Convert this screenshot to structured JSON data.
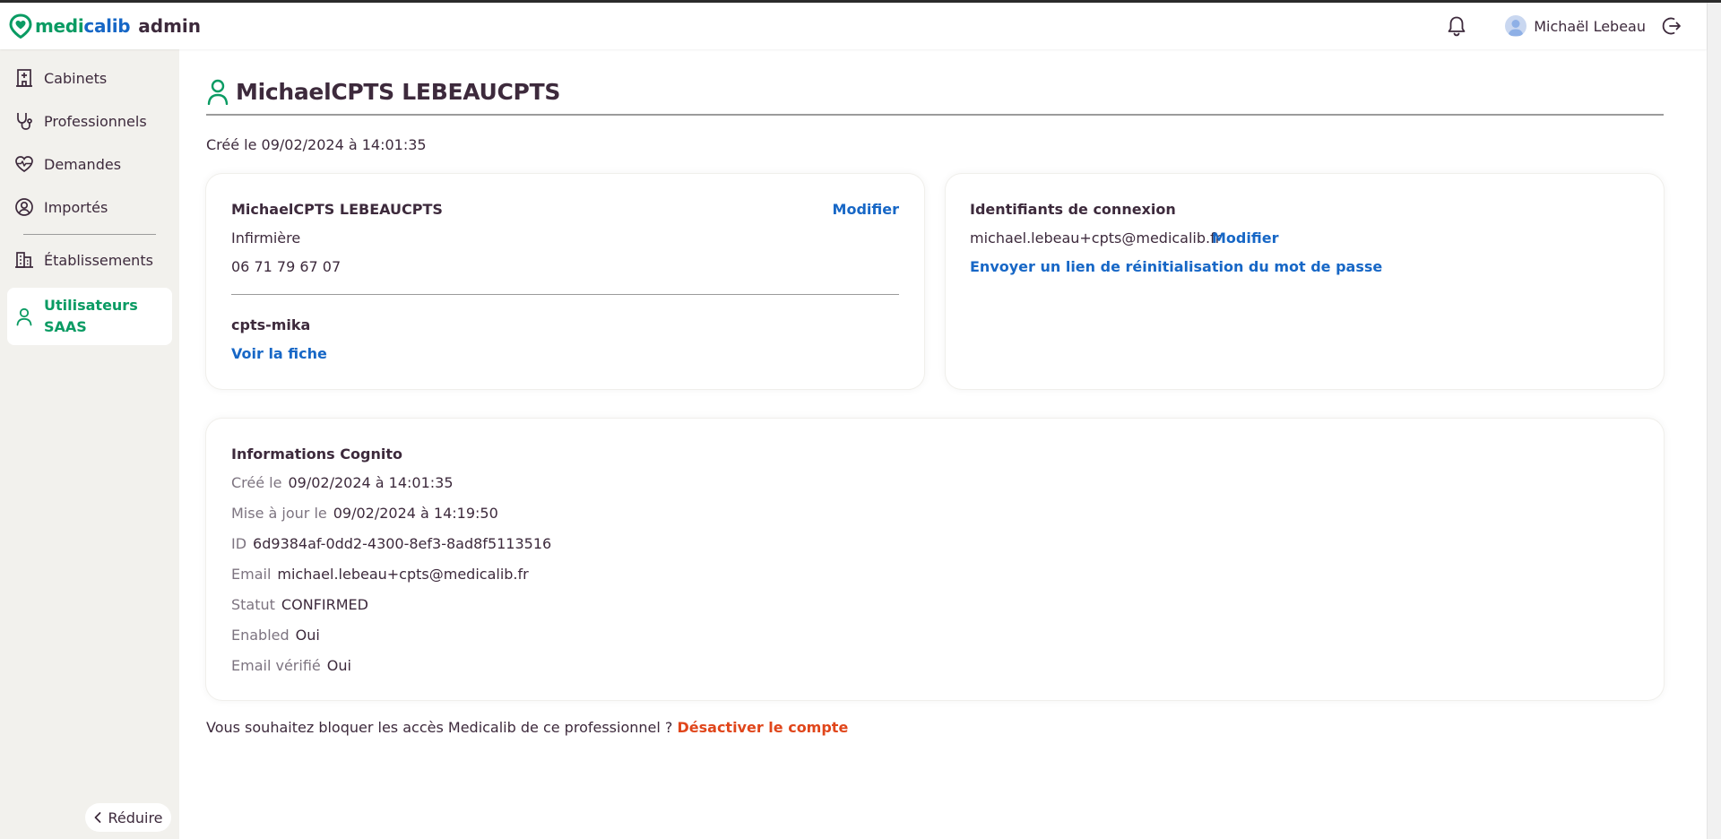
{
  "brand": {
    "logo_part1": "medi",
    "logo_part2": "calib",
    "suffix": "admin",
    "colors": {
      "green": "#0a9b63",
      "blue": "#1767c6",
      "dark": "#3d2a3c",
      "danger": "#e0461b"
    }
  },
  "header": {
    "user_name": "Michaël Lebeau",
    "icons": [
      "bell-icon",
      "avatar",
      "logout-icon"
    ]
  },
  "sidebar": {
    "items": [
      {
        "label": "Cabinets",
        "icon": "building-icon"
      },
      {
        "label": "Professionnels",
        "icon": "stethoscope-icon"
      },
      {
        "label": "Demandes",
        "icon": "heartbeat-icon"
      },
      {
        "label": "Importés",
        "icon": "user-circle-icon"
      },
      {
        "label": "Établissements",
        "icon": "hospital-icon"
      },
      {
        "label": "Utilisateurs SAAS",
        "icon": "user-icon",
        "active": true
      }
    ],
    "reduce_label": "Réduire"
  },
  "page": {
    "title": "MichaelCPTS LEBEAUCPTS",
    "created": "Créé le 09/02/2024 à 14:01:35"
  },
  "profile_card": {
    "name": "MichaelCPTS LEBEAUCPTS",
    "edit_label": "Modifier",
    "profession": "Infirmière",
    "phone": "06 71 79 67 07",
    "org": "cpts-mika",
    "view_label": "Voir la fiche"
  },
  "login_card": {
    "title": "Identifiants de connexion",
    "email": "michael.lebeau+cpts@medicalib.fr",
    "edit_label": "Modifier",
    "reset_label": "Envoyer un lien de réinitialisation du mot de passe"
  },
  "cognito": {
    "title": "Informations Cognito",
    "rows": [
      {
        "key": "Créé le",
        "value": "09/02/2024 à 14:01:35"
      },
      {
        "key": "Mise à jour le",
        "value": "09/02/2024 à 14:19:50"
      },
      {
        "key": "ID",
        "value": "6d9384af-0dd2-4300-8ef3-8ad8f5113516"
      },
      {
        "key": "Email",
        "value": "michael.lebeau+cpts@medicalib.fr"
      },
      {
        "key": "Statut",
        "value": "CONFIRMED"
      },
      {
        "key": "Enabled",
        "value": "Oui"
      },
      {
        "key": "Email vérifié",
        "value": "Oui"
      }
    ]
  },
  "footer": {
    "question": "Vous souhaitez bloquer les accès Medicalib de ce professionnel ?",
    "deactivate_label": "Désactiver le compte"
  }
}
